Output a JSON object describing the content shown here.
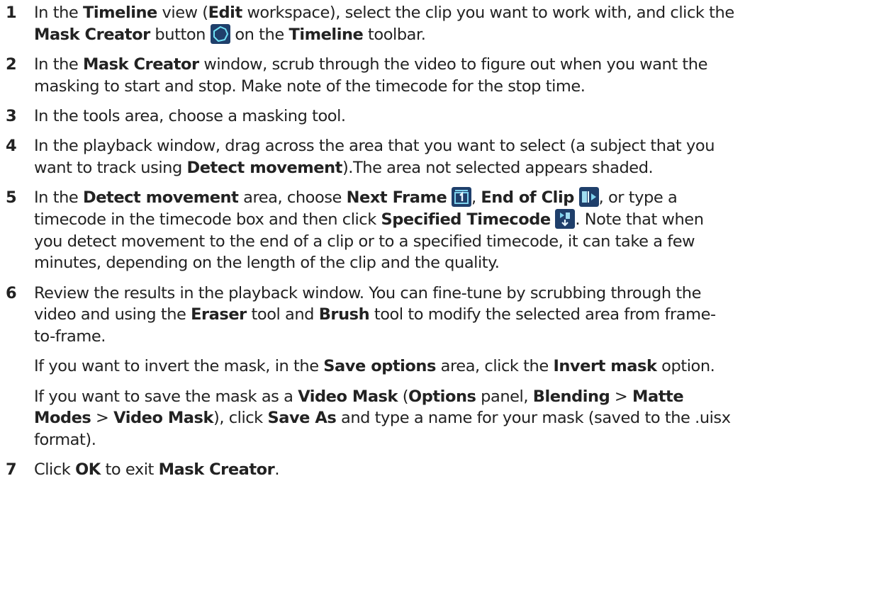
{
  "steps": [
    {
      "number": "1",
      "lines": [
        [
          "In the ",
          {
            "b": "Timeline"
          },
          " view (",
          {
            "b": "Edit"
          },
          " workspace), select the clip you want to work with, and click the"
        ],
        [
          {
            "b": "Mask Creator"
          },
          " button ",
          {
            "icon": "mask-creator-icon"
          },
          " on the ",
          {
            "b": "Timeline"
          },
          " toolbar."
        ]
      ]
    },
    {
      "number": "2",
      "lines": [
        [
          "In the ",
          {
            "b": "Mask Creator"
          },
          " window, scrub through the video to figure out when you want the"
        ],
        [
          "masking to start and stop. Make note of the timecode for the stop time."
        ]
      ]
    },
    {
      "number": "3",
      "lines": [
        [
          "In the tools area, choose a masking tool."
        ]
      ]
    },
    {
      "number": "4",
      "lines": [
        [
          "In the playback window, drag across the area that you want to select (a subject that you"
        ],
        [
          "want to track using ",
          {
            "b": "Detect movement"
          },
          ").The area not selected appears shaded."
        ]
      ]
    },
    {
      "number": "5",
      "lines": [
        [
          "In the ",
          {
            "b": "Detect movement"
          },
          " area, choose ",
          {
            "b": "Next Frame"
          },
          " ",
          {
            "icon": "next-frame-icon"
          },
          ", ",
          {
            "b": "End of Clip"
          },
          " ",
          {
            "icon": "end-of-clip-icon"
          },
          ", or type a"
        ],
        [
          "timecode in the timecode box and then click ",
          {
            "b": "Specified Timecode"
          },
          " ",
          {
            "icon": "specified-timecode-icon"
          },
          ". Note that when"
        ],
        [
          "you detect movement to the end of a clip or to a specified timecode, it can take a few"
        ],
        [
          "minutes, depending on the length of the clip and the quality."
        ]
      ]
    },
    {
      "number": "6",
      "lines": [
        [
          "Review the results in the playback window. You can fine-tune by scrubbing through the"
        ],
        [
          "video and using the ",
          {
            "b": "Eraser"
          },
          " tool and ",
          {
            "b": "Brush"
          },
          " tool to modify the selected area from frame-"
        ],
        [
          "to-frame."
        ]
      ]
    },
    {
      "number": "",
      "lines": [
        [
          "If you want to invert the mask, in the ",
          {
            "b": "Save options"
          },
          " area, click the ",
          {
            "b": "Invert mask"
          },
          " option."
        ]
      ]
    },
    {
      "number": "",
      "lines": [
        [
          "If you want to save the mask as a ",
          {
            "b": "Video Mask"
          },
          " (",
          {
            "b": "Options"
          },
          " panel, ",
          {
            "b": "Blending"
          },
          " > ",
          {
            "b": "Matte"
          }
        ],
        [
          {
            "b": "Modes"
          },
          " > ",
          {
            "b": "Video Mask"
          },
          "), click ",
          {
            "b": "Save As"
          },
          " and type a name for your mask (saved to the .uisx"
        ],
        [
          "format)."
        ]
      ]
    },
    {
      "number": "7",
      "lines": [
        [
          "Click ",
          {
            "b": "OK"
          },
          " to exit ",
          {
            "b": "Mask Creator"
          },
          "."
        ]
      ]
    }
  ]
}
